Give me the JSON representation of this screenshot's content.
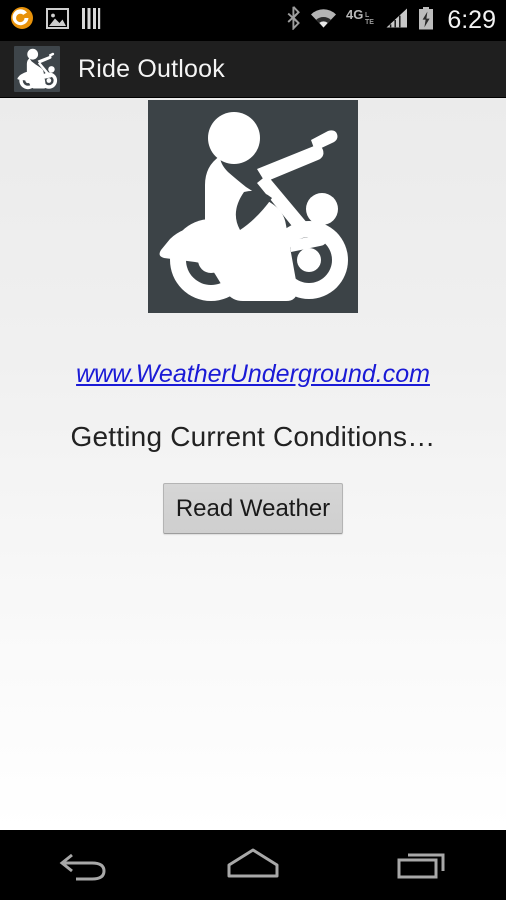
{
  "status_bar": {
    "time": "6:29",
    "left_icons": [
      {
        "name": "app-notification-icon",
        "label": "orange-circle-swirl"
      },
      {
        "name": "image-notification-icon",
        "label": "picture"
      },
      {
        "name": "bars-notification-icon",
        "label": "vertical-bars"
      }
    ],
    "right_icons": [
      {
        "name": "bluetooth-icon",
        "label": "bluetooth"
      },
      {
        "name": "wifi-icon",
        "label": "wifi"
      },
      {
        "name": "network-4glte-icon",
        "label": "4G LTE"
      },
      {
        "name": "signal-strength-icon",
        "label": "signal-bars"
      },
      {
        "name": "battery-charging-icon",
        "label": "battery-charging"
      }
    ]
  },
  "action_bar": {
    "title": "Ride Outlook",
    "icon": "motorcycle-icon"
  },
  "main": {
    "hero_image_alt": "motorcycle-rider-silhouette",
    "weather_link": "www.WeatherUnderground.com",
    "status_message": "Getting Current Conditions…",
    "read_weather_label": "Read Weather"
  },
  "nav_bar": {
    "back_label": "Back",
    "home_label": "Home",
    "recents_label": "Recent apps"
  },
  "colors": {
    "status_bar_bg": "#000000",
    "action_bar_bg": "#1f1f1f",
    "content_bg_top": "#ebebeb",
    "content_bg_bottom": "#ffffff",
    "link_color": "#1a1ad6",
    "hero_bg": "#3c4347",
    "button_bg": "#d2d2d2",
    "nav_bar_bg": "#000000"
  }
}
